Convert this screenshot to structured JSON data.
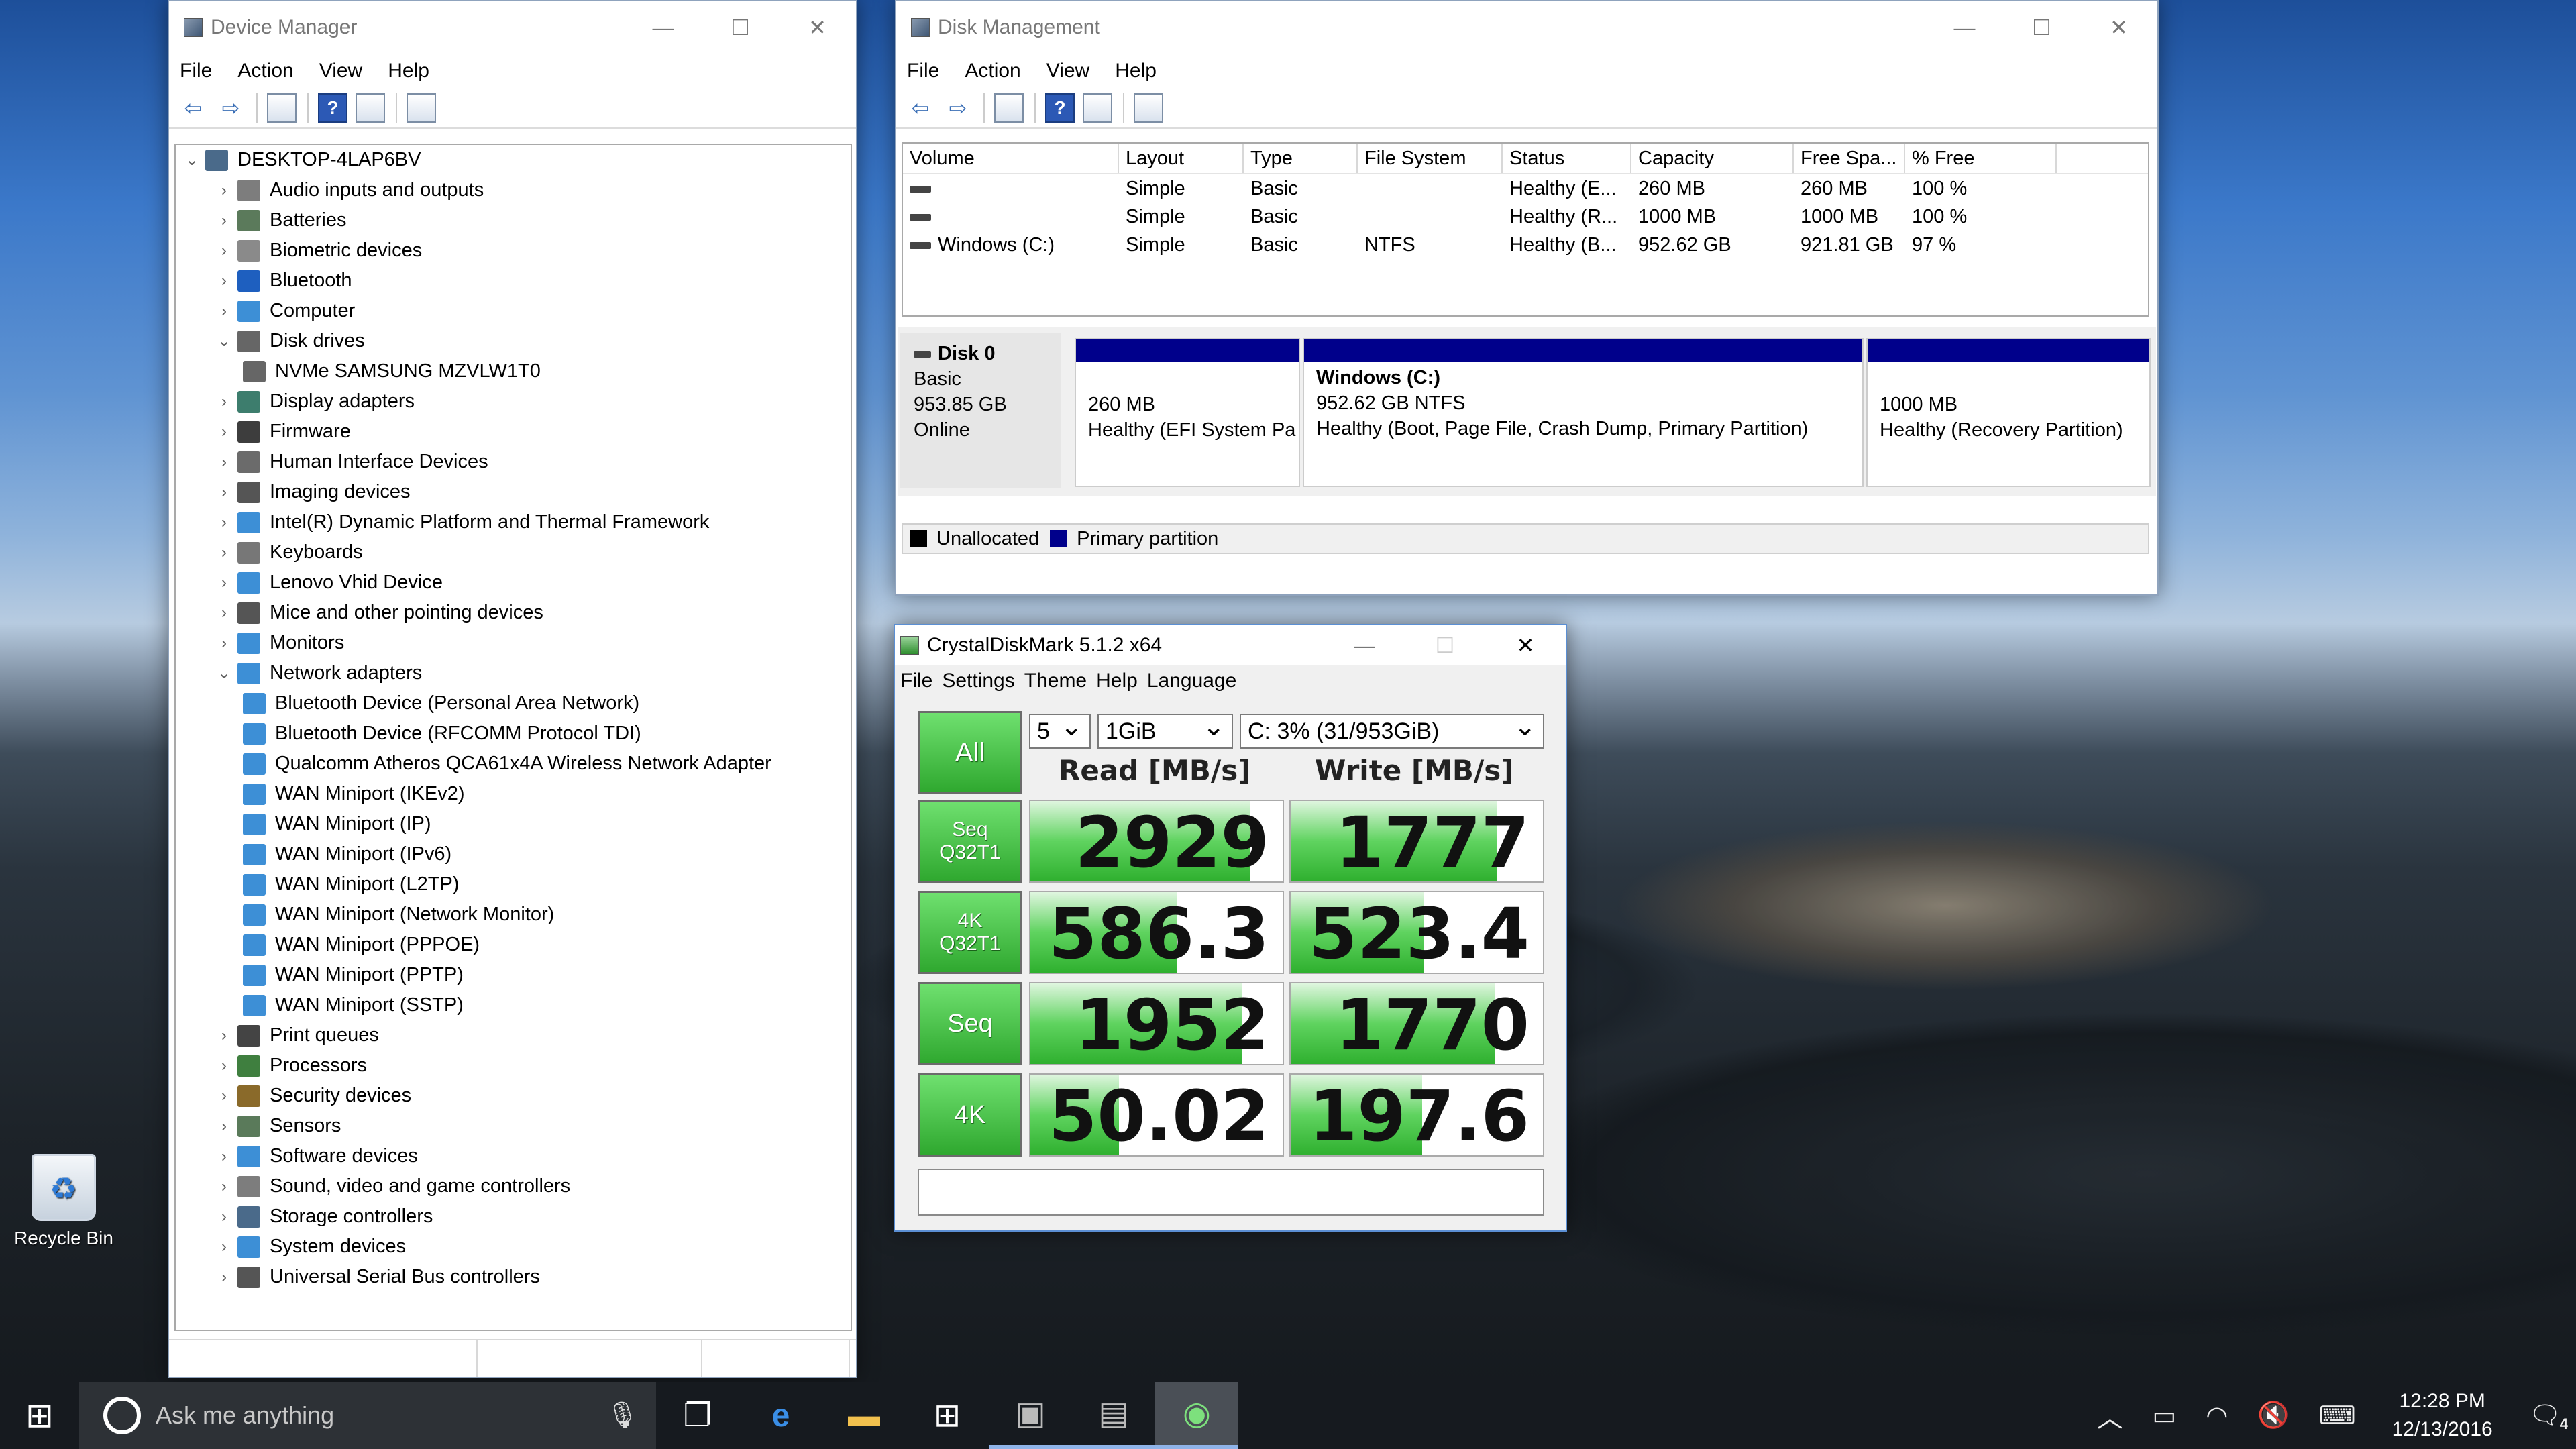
{
  "desktop": {
    "recycle_bin": "Recycle Bin"
  },
  "device_manager": {
    "title": "Device Manager",
    "menu": [
      "File",
      "Action",
      "View",
      "Help"
    ],
    "root": "DESKTOP-4LAP6BV",
    "items": [
      {
        "label": "Audio inputs and outputs",
        "level": 1,
        "expander": "›",
        "icon": "speaker-icon",
        "color": "#7d7d7d"
      },
      {
        "label": "Batteries",
        "level": 1,
        "expander": "›",
        "icon": "battery-icon",
        "color": "#5b7a5b"
      },
      {
        "label": "Biometric devices",
        "level": 1,
        "expander": "›",
        "icon": "fingerprint-icon",
        "color": "#8a8a8a"
      },
      {
        "label": "Bluetooth",
        "level": 1,
        "expander": "›",
        "icon": "bluetooth-icon",
        "color": "#1e5fbf"
      },
      {
        "label": "Computer",
        "level": 1,
        "expander": "›",
        "icon": "computer-icon",
        "color": "#3d8fd6"
      },
      {
        "label": "Disk drives",
        "level": 1,
        "expander": "⌄",
        "icon": "disk-drive-icon",
        "color": "#666666"
      },
      {
        "label": "NVMe SAMSUNG MZVLW1T0",
        "level": 2,
        "expander": "",
        "icon": "disk-drive-icon",
        "color": "#666666"
      },
      {
        "label": "Display adapters",
        "level": 1,
        "expander": "›",
        "icon": "display-adapter-icon",
        "color": "#3d7d6d"
      },
      {
        "label": "Firmware",
        "level": 1,
        "expander": "›",
        "icon": "chip-icon",
        "color": "#3d3d3d"
      },
      {
        "label": "Human Interface Devices",
        "level": 1,
        "expander": "›",
        "icon": "hid-icon",
        "color": "#6b6b6b"
      },
      {
        "label": "Imaging devices",
        "level": 1,
        "expander": "›",
        "icon": "camera-icon",
        "color": "#555555"
      },
      {
        "label": "Intel(R) Dynamic Platform and Thermal Framework",
        "level": 1,
        "expander": "›",
        "icon": "thermal-icon",
        "color": "#3d8fd6"
      },
      {
        "label": "Keyboards",
        "level": 1,
        "expander": "›",
        "icon": "keyboard-icon",
        "color": "#777777"
      },
      {
        "label": "Lenovo Vhid Device",
        "level": 1,
        "expander": "›",
        "icon": "monitor-icon",
        "color": "#3d8fd6"
      },
      {
        "label": "Mice and other pointing devices",
        "level": 1,
        "expander": "›",
        "icon": "mouse-icon",
        "color": "#555555"
      },
      {
        "label": "Monitors",
        "level": 1,
        "expander": "›",
        "icon": "monitor-icon",
        "color": "#3d8fd6"
      },
      {
        "label": "Network adapters",
        "level": 1,
        "expander": "⌄",
        "icon": "network-adapter-icon",
        "color": "#3d8fd6"
      },
      {
        "label": "Bluetooth Device (Personal Area Network)",
        "level": 2,
        "expander": "",
        "icon": "network-adapter-icon",
        "color": "#3d8fd6"
      },
      {
        "label": "Bluetooth Device (RFCOMM Protocol TDI)",
        "level": 2,
        "expander": "",
        "icon": "network-adapter-icon",
        "color": "#3d8fd6"
      },
      {
        "label": "Qualcomm Atheros QCA61x4A Wireless Network Adapter",
        "level": 2,
        "expander": "",
        "icon": "network-adapter-icon",
        "color": "#3d8fd6"
      },
      {
        "label": "WAN Miniport (IKEv2)",
        "level": 2,
        "expander": "",
        "icon": "network-adapter-icon",
        "color": "#3d8fd6"
      },
      {
        "label": "WAN Miniport (IP)",
        "level": 2,
        "expander": "",
        "icon": "network-adapter-icon",
        "color": "#3d8fd6"
      },
      {
        "label": "WAN Miniport (IPv6)",
        "level": 2,
        "expander": "",
        "icon": "network-adapter-icon",
        "color": "#3d8fd6"
      },
      {
        "label": "WAN Miniport (L2TP)",
        "level": 2,
        "expander": "",
        "icon": "network-adapter-icon",
        "color": "#3d8fd6"
      },
      {
        "label": "WAN Miniport (Network Monitor)",
        "level": 2,
        "expander": "",
        "icon": "network-adapter-icon",
        "color": "#3d8fd6"
      },
      {
        "label": "WAN Miniport (PPPOE)",
        "level": 2,
        "expander": "",
        "icon": "network-adapter-icon",
        "color": "#3d8fd6"
      },
      {
        "label": "WAN Miniport (PPTP)",
        "level": 2,
        "expander": "",
        "icon": "network-adapter-icon",
        "color": "#3d8fd6"
      },
      {
        "label": "WAN Miniport (SSTP)",
        "level": 2,
        "expander": "",
        "icon": "network-adapter-icon",
        "color": "#3d8fd6"
      },
      {
        "label": "Print queues",
        "level": 1,
        "expander": "›",
        "icon": "printer-icon",
        "color": "#444444"
      },
      {
        "label": "Processors",
        "level": 1,
        "expander": "›",
        "icon": "processor-icon",
        "color": "#3f7f3f"
      },
      {
        "label": "Security devices",
        "level": 1,
        "expander": "›",
        "icon": "security-key-icon",
        "color": "#8a6a2a"
      },
      {
        "label": "Sensors",
        "level": 1,
        "expander": "›",
        "icon": "sensor-icon",
        "color": "#5a7a5a"
      },
      {
        "label": "Software devices",
        "level": 1,
        "expander": "›",
        "icon": "software-device-icon",
        "color": "#3d8fd6"
      },
      {
        "label": "Sound, video and game controllers",
        "level": 1,
        "expander": "›",
        "icon": "speaker-icon",
        "color": "#7d7d7d"
      },
      {
        "label": "Storage controllers",
        "level": 1,
        "expander": "›",
        "icon": "storage-controller-icon",
        "color": "#4a6a8a"
      },
      {
        "label": "System devices",
        "level": 1,
        "expander": "›",
        "icon": "system-device-icon",
        "color": "#3d8fd6"
      },
      {
        "label": "Universal Serial Bus controllers",
        "level": 1,
        "expander": "›",
        "icon": "usb-icon",
        "color": "#555555"
      }
    ]
  },
  "disk_management": {
    "title": "Disk Management",
    "menu": [
      "File",
      "Action",
      "View",
      "Help"
    ],
    "columns": [
      "Volume",
      "Layout",
      "Type",
      "File System",
      "Status",
      "Capacity",
      "Free Spa...",
      "% Free"
    ],
    "rows": [
      [
        "",
        "Simple",
        "Basic",
        "",
        "Healthy (E...",
        "260 MB",
        "260 MB",
        "100 %"
      ],
      [
        "",
        "Simple",
        "Basic",
        "",
        "Healthy (R...",
        "1000 MB",
        "1000 MB",
        "100 %"
      ],
      [
        "Windows (C:)",
        "Simple",
        "Basic",
        "NTFS",
        "Healthy (B...",
        "952.62 GB",
        "921.81 GB",
        "97 %"
      ]
    ],
    "disk": {
      "name": "Disk 0",
      "type": "Basic",
      "size": "953.85 GB",
      "state": "Online"
    },
    "partitions": [
      {
        "title": "",
        "size": "260 MB",
        "status": "Healthy (EFI System Pa"
      },
      {
        "title": "Windows  (C:)",
        "size": "952.62 GB NTFS",
        "status": "Healthy (Boot, Page File, Crash Dump, Primary Partition)"
      },
      {
        "title": "",
        "size": "1000 MB",
        "status": "Healthy (Recovery Partition)"
      }
    ],
    "legend": {
      "unallocated": "Unallocated",
      "primary": "Primary partition",
      "unallocated_color": "#000000",
      "primary_color": "#00008b"
    }
  },
  "crystaldiskmark": {
    "title": "CrystalDiskMark 5.1.2 x64",
    "menu": [
      "File",
      "Settings",
      "Theme",
      "Help",
      "Language"
    ],
    "all_button": "All",
    "count": "5",
    "size": "1GiB",
    "drive": "C: 3% (31/953GiB)",
    "read_header": "Read [MB/s]",
    "write_header": "Write [MB/s]",
    "tests": [
      {
        "line1": "Seq",
        "line2": "Q32T1",
        "read": "2929",
        "write": "1777",
        "read_fill": 0.87,
        "write_fill": 0.82
      },
      {
        "line1": "4K",
        "line2": "Q32T1",
        "read": "586.3",
        "write": "523.4",
        "read_fill": 0.58,
        "write_fill": 0.53
      },
      {
        "line1": "Seq",
        "line2": "",
        "read": "1952",
        "write": "1770",
        "read_fill": 0.84,
        "write_fill": 0.81
      },
      {
        "line1": "4K",
        "line2": "",
        "read": "50.02",
        "write": "197.6",
        "read_fill": 0.35,
        "write_fill": 0.52
      }
    ]
  },
  "taskbar": {
    "search_placeholder": "Ask me anything",
    "time": "12:28 PM",
    "date": "12/13/2016",
    "notifications": "4"
  }
}
